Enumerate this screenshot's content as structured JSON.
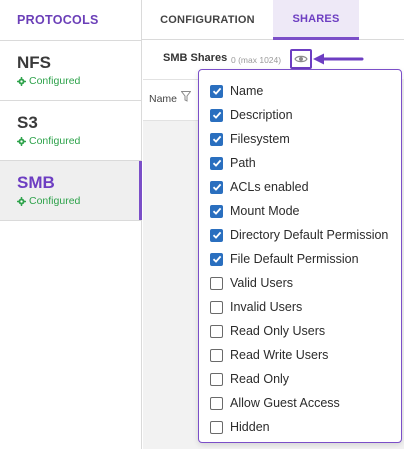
{
  "sidebar": {
    "title": "PROTOCOLS",
    "items": [
      {
        "name": "NFS",
        "status": "Configured",
        "active": false
      },
      {
        "name": "S3",
        "status": "Configured",
        "active": false
      },
      {
        "name": "SMB",
        "status": "Configured",
        "active": true
      }
    ]
  },
  "tabs": [
    {
      "label": "CONFIGURATION",
      "active": false
    },
    {
      "label": "SHARES",
      "active": true
    }
  ],
  "shares": {
    "title": "SMB Shares",
    "count": "0 (max 1024)",
    "column_header": "Name"
  },
  "column_menu": {
    "options": [
      {
        "label": "Name",
        "checked": true
      },
      {
        "label": "Description",
        "checked": true
      },
      {
        "label": "Filesystem",
        "checked": true
      },
      {
        "label": "Path",
        "checked": true
      },
      {
        "label": "ACLs enabled",
        "checked": true
      },
      {
        "label": "Mount Mode",
        "checked": true
      },
      {
        "label": "Directory Default Permission",
        "checked": true
      },
      {
        "label": "File Default Permission",
        "checked": true
      },
      {
        "label": "Valid Users",
        "checked": false
      },
      {
        "label": "Invalid Users",
        "checked": false
      },
      {
        "label": "Read Only Users",
        "checked": false
      },
      {
        "label": "Read Write Users",
        "checked": false
      },
      {
        "label": "Read Only",
        "checked": false
      },
      {
        "label": "Allow Guest Access",
        "checked": false
      },
      {
        "label": "Hidden",
        "checked": false
      }
    ]
  },
  "colors": {
    "accent": "#7b4fc8",
    "status_ok": "#2ea24b",
    "checkbox": "#2a6fbf"
  },
  "icons": {
    "status": "gear-icon",
    "column_toggle": "eye-icon",
    "filter": "filter-icon"
  }
}
